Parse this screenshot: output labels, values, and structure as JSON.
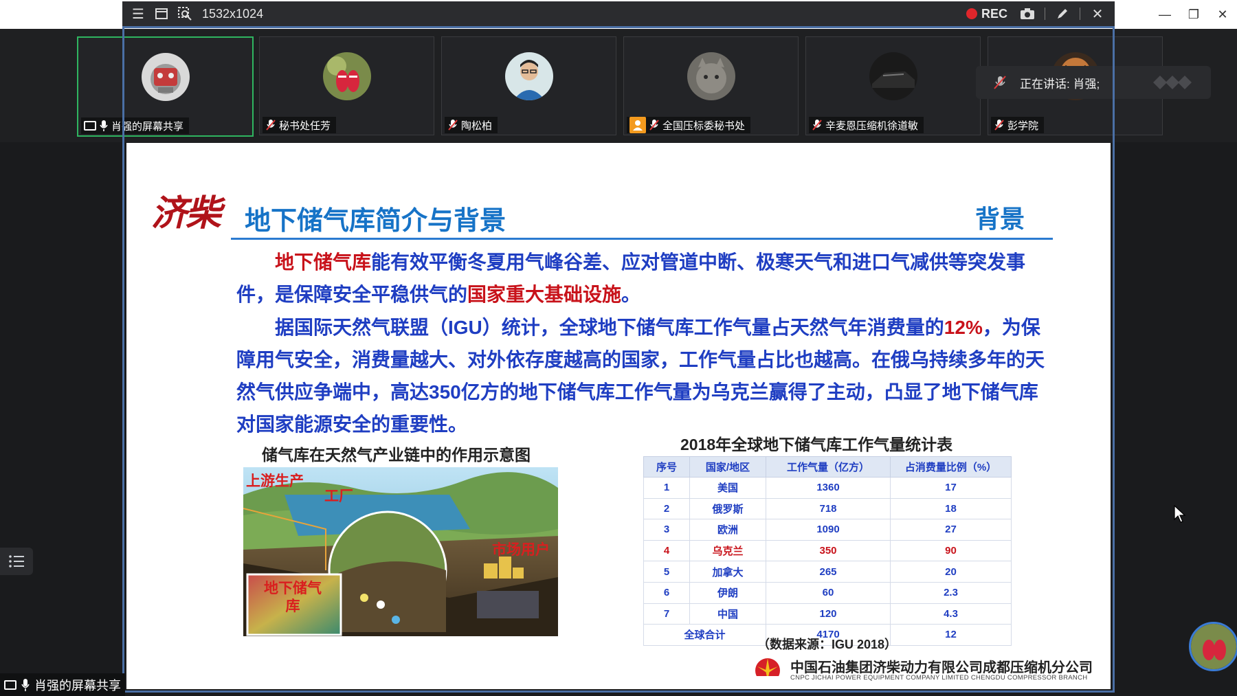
{
  "toolbar": {
    "resolution": "1532x1024",
    "rec_label": "REC"
  },
  "participants": [
    {
      "name": "肖强的屏幕共享",
      "avatar_icon": "robot-avatar",
      "active": true
    },
    {
      "name": "秘书处任芳",
      "avatar_icon": "shoes-avatar"
    },
    {
      "name": "陶松柏",
      "avatar_icon": "person-avatar"
    },
    {
      "name": "全国压标委秘书处",
      "avatar_icon": "cat-avatar"
    },
    {
      "name": "辛麦恩压缩机徐道敏",
      "avatar_icon": "car-avatar"
    },
    {
      "name": "彭学院",
      "avatar_icon": "tiger-avatar"
    }
  ],
  "speaking": {
    "label": "正在讲话: 肖强;"
  },
  "slide": {
    "logo_text": "济柴",
    "title": "地下储气库简介与背景",
    "tag": "背景",
    "para1_red": "地下储气库",
    "para1_blue": "能有效平衡冬夏用气峰谷差、应对管道中断、极寒天气和进口气减供等突发事件，是保障安全平稳供气的",
    "para1_red2": "国家重大基础设施",
    "para1_end": "。",
    "para2_a": "据国际天然气联盟（IGU）统计，全球地下储气库工作气量占天然气年消费量的",
    "para2_pct": "12%",
    "para2_b": "，为保障用气安全，消费量越大、对外依存度越高的国家，工作气量占比也越高。在俄乌持续多年的天然气供应争端中，高达350亿方的地下储气库工作气量为乌克兰赢得了主动，凸显了地下储气库对国家能源安全的重要性。",
    "illus_caption": "储气库在天然气产业链中的作用示意图",
    "illus_labels": {
      "upstream": "上游生产",
      "factory": "工厂",
      "market": "市场用户",
      "storage": "地下储气库"
    },
    "table_title": "2018年全球地下储气库工作气量统计表",
    "table_headers": [
      "序号",
      "国家/地区",
      "工作气量（亿方）",
      "占消费量比例（%）"
    ],
    "table_rows": [
      [
        "1",
        "美国",
        "1360",
        "17"
      ],
      [
        "2",
        "俄罗斯",
        "718",
        "18"
      ],
      [
        "3",
        "欧洲",
        "1090",
        "27"
      ],
      [
        "4",
        "乌克兰",
        "350",
        "90"
      ],
      [
        "5",
        "加拿大",
        "265",
        "20"
      ],
      [
        "6",
        "伊朗",
        "60",
        "2.3"
      ],
      [
        "7",
        "中国",
        "120",
        "4.3"
      ]
    ],
    "table_total": [
      "全球合计",
      "4170",
      "12"
    ],
    "source": "（数据来源：IGU  2018）",
    "footer_cn": "中国石油集团济柴动力有限公司成都压缩机分公司",
    "footer_en": "CNPC JICHAI POWER EQUIPMENT COMPANY LIMITED CHENGDU COMPRESSOR BRANCH"
  },
  "bottom_share_label": "肖强的屏幕共享",
  "colors": {
    "accent_blue": "#1673c7",
    "text_blue": "#1f3ec2",
    "highlight_red": "#c8121a",
    "active_tile": "#2fb560",
    "rec_red": "#e0262b"
  }
}
